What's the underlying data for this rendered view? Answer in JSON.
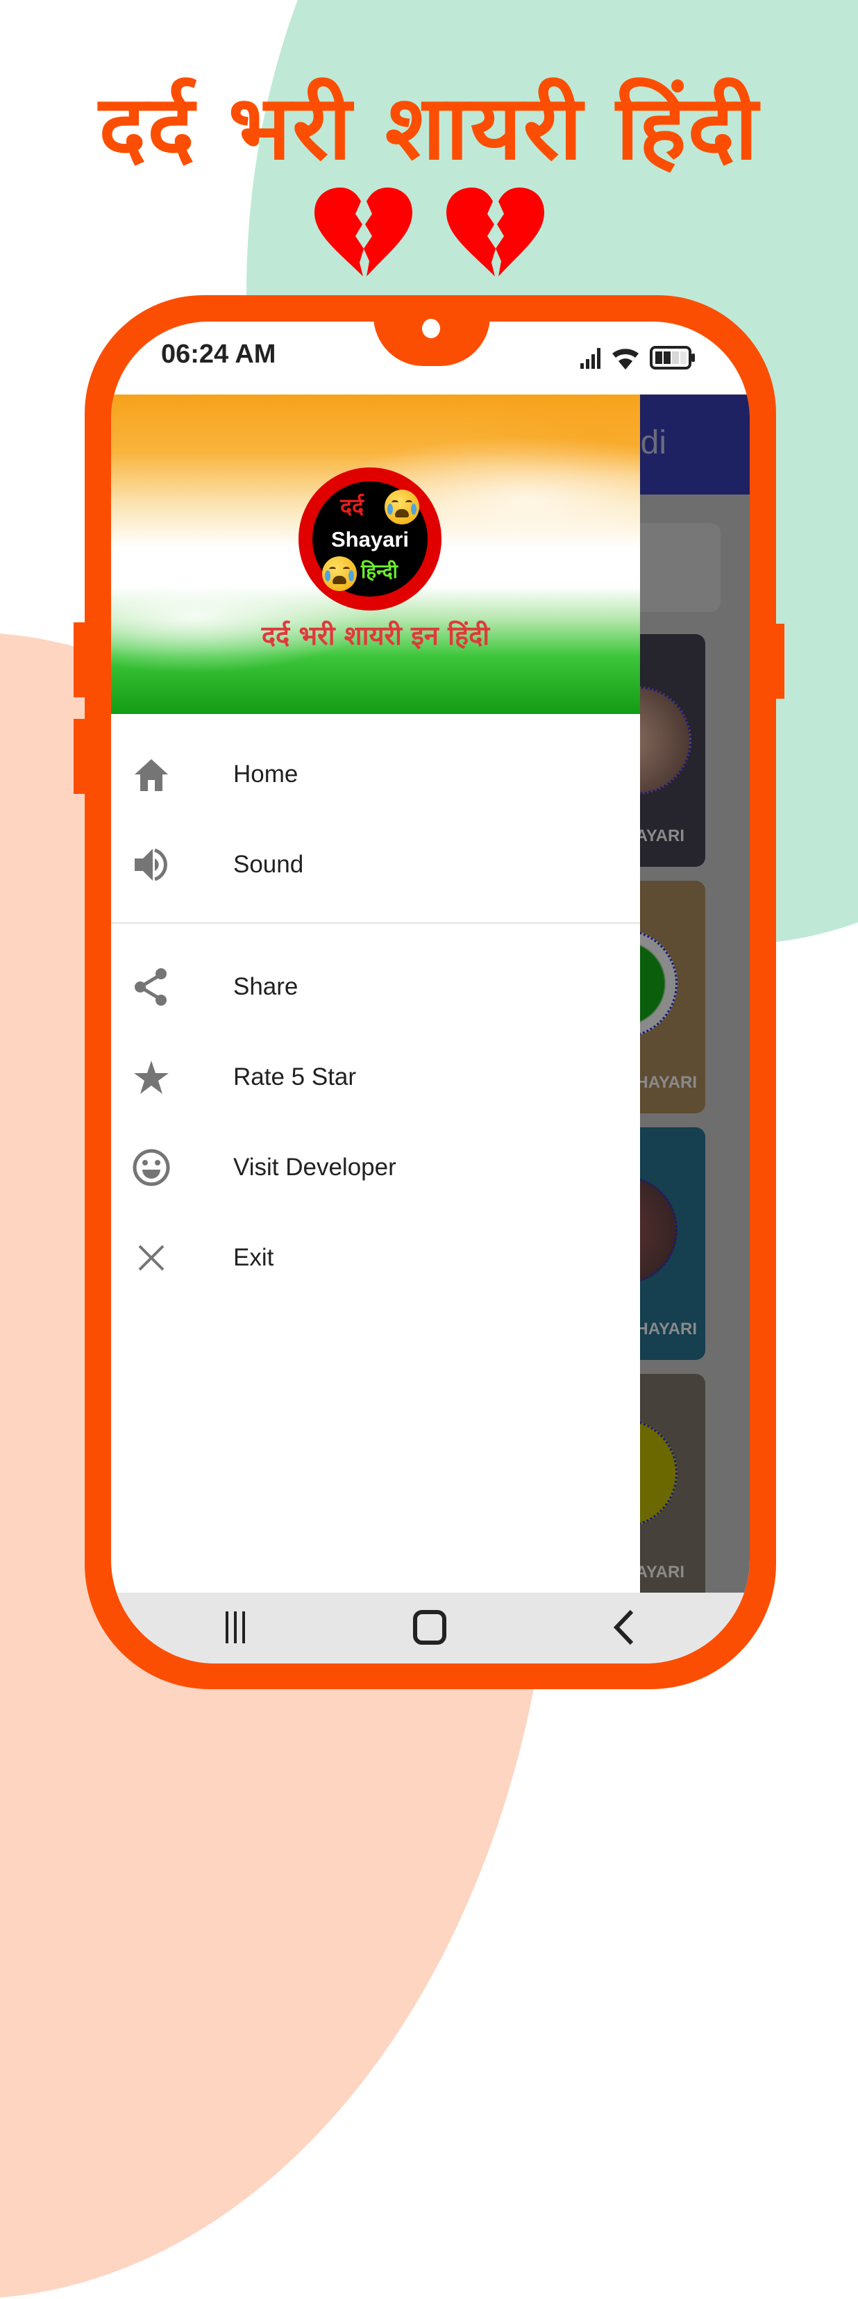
{
  "promo": {
    "title": "दर्द भरी शायरी हिंदी",
    "hearts": [
      "broken-heart-icon",
      "broken-heart-icon"
    ],
    "colors": {
      "accent": "#FC4E02",
      "mint": "#BFE9D6",
      "peach": "#FDD5C1",
      "heart": "#FF0000"
    }
  },
  "status_bar": {
    "time": "06:24 AM",
    "icons": [
      "signal-icon",
      "wifi-icon",
      "battery-icon"
    ],
    "battery_level_fraction": 0.5
  },
  "app_behind": {
    "title_fragment": "di",
    "app_bar_color": "#1F2262",
    "cards": [
      {
        "label": "HAYARI",
        "color": "#26242C"
      },
      {
        "label": "P SHAYARI",
        "color": "#5E4D33"
      },
      {
        "label": "C SHAYARI",
        "color": "#163F4F"
      },
      {
        "label": "AYARI",
        "color": "#46413A"
      }
    ]
  },
  "drawer": {
    "header": {
      "logo": {
        "line1": "दर्द",
        "line2": "Shayari",
        "line3": "हिन्दी"
      },
      "subtitle": "दर्द भरी शायरी इन हिंदी"
    },
    "groups": [
      [
        {
          "icon": "home-icon",
          "label": "Home"
        },
        {
          "icon": "volume-icon",
          "label": "Sound"
        }
      ],
      [
        {
          "icon": "share-icon",
          "label": "Share"
        },
        {
          "icon": "star-icon",
          "label": "Rate 5 Star"
        },
        {
          "icon": "smiley-icon",
          "label": "Visit Developer"
        },
        {
          "icon": "close-icon",
          "label": "Exit"
        }
      ]
    ]
  },
  "nav_bar": {
    "buttons": [
      "recent-apps-icon",
      "home-button-icon",
      "back-icon"
    ]
  }
}
